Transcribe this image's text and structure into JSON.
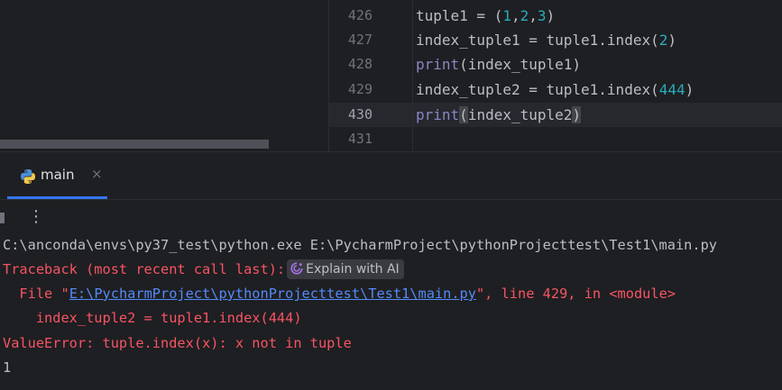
{
  "editor": {
    "lines": [
      {
        "num": "426",
        "active": false
      },
      {
        "num": "427",
        "active": false
      },
      {
        "num": "428",
        "active": false
      },
      {
        "num": "429",
        "active": false
      },
      {
        "num": "430",
        "active": true
      },
      {
        "num": "431",
        "active": false
      }
    ],
    "code": {
      "l426": {
        "a": "tuple1 = (",
        "n1": "1",
        "c1": ",",
        "n2": "2",
        "c2": ",",
        "n3": "3",
        "b": ")"
      },
      "l427": {
        "a": "index_tuple1 = tuple1.index(",
        "n": "2",
        "b": ")"
      },
      "l428": {
        "fn": "print",
        "b": "(index_tuple1)"
      },
      "l429": {
        "a": "index_tuple2 = tuple1.index(",
        "n": "444",
        "b": ")"
      },
      "l430": {
        "fn": "print",
        "open": "(",
        "mid": "index_tuple2",
        "close": ")"
      }
    }
  },
  "run_window": {
    "tab_label": "main",
    "tab_close": "×",
    "more_label": "⋮"
  },
  "console": {
    "cmd": "C:\\anconda\\envs\\py37_test\\python.exe E:\\PycharmProject\\pythonProjecttest\\Test1\\main.py",
    "traceback": "Traceback (most recent call last):",
    "explain_ai": "Explain with AI",
    "file_prefix": "  File \"",
    "file_path": "E:\\PycharmProject\\pythonProjecttest\\Test1\\main.py",
    "file_suffix": "\", line 429, in <module>",
    "source_line": "    index_tuple2 = tuple1.index(444)",
    "error": "ValueError: tuple.index(x): x not in tuple",
    "output": "1"
  },
  "colors": {
    "background": "#1e1f22",
    "error_red": "#f75464",
    "link_blue": "#548af7",
    "number_cyan": "#2aacb8",
    "builtin_purple": "#8888c6",
    "tab_accent": "#3574f0"
  }
}
